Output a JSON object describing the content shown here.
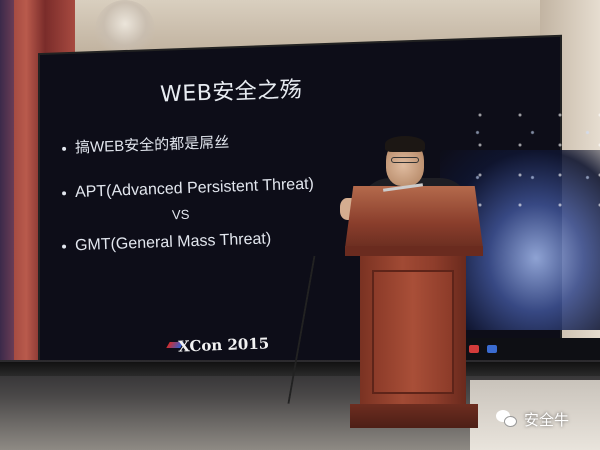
{
  "slide": {
    "title": "WEB安全之殇",
    "bullets": [
      "搞WEB安全的都是屌丝",
      "APT(Advanced Persistent Threat)",
      "GMT(General Mass Threat)"
    ],
    "vs": "VS",
    "footer_logo": "XCon 2015"
  },
  "watermark": {
    "text": "安全牛",
    "icon": "wechat-icon"
  },
  "colors": {
    "screen_bg": "#0d0d18",
    "slide_text": "#e2e6ee",
    "podium": "#8e3d2b",
    "curtain": "#a74a40"
  }
}
